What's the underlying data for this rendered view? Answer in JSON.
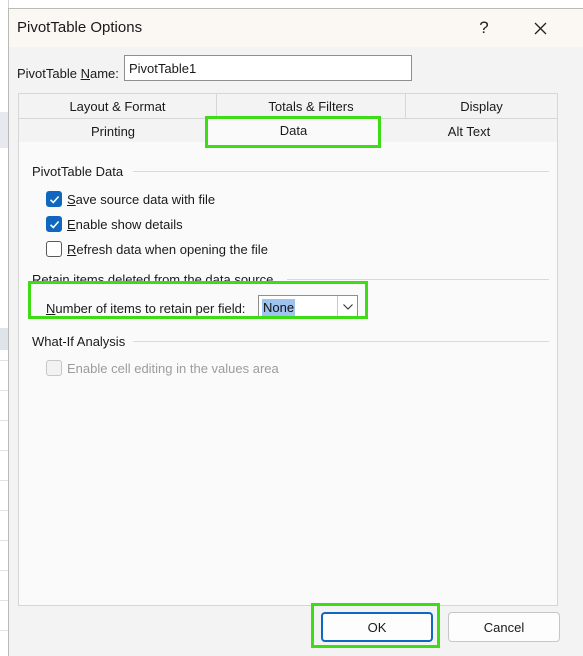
{
  "dialog": {
    "title": "PivotTable Options",
    "help_glyph": "?",
    "close_icon": "close-icon"
  },
  "name_field": {
    "label_prefix": "PivotTable ",
    "label_accel": "N",
    "label_suffix": "ame:",
    "value": "PivotTable1"
  },
  "tabs": {
    "row1": [
      {
        "label": "Layout & Format"
      },
      {
        "label": "Totals & Filters"
      },
      {
        "label": "Display"
      }
    ],
    "row2": [
      {
        "label": "Printing"
      },
      {
        "label": "Data",
        "active": true
      },
      {
        "label": "Alt Text"
      }
    ]
  },
  "pivot_data": {
    "heading": "PivotTable Data",
    "save": {
      "accel": "S",
      "rest": "ave source data with file",
      "checked": true
    },
    "enable": {
      "accel": "E",
      "rest": "nable show details",
      "checked": true
    },
    "refresh": {
      "accel": "R",
      "rest": "efresh data when opening the file",
      "checked": false
    }
  },
  "retain": {
    "heading": "Retain items deleted from the data source",
    "label_accel": "N",
    "label_rest": "umber of items to retain per field:",
    "value": "None"
  },
  "whatif": {
    "heading": "What-If Analysis",
    "option_label": "Enable cell editing in the values area",
    "checked": false,
    "disabled": true
  },
  "buttons": {
    "ok": "OK",
    "cancel": "Cancel"
  },
  "colors": {
    "highlight": "#3ddc14",
    "accent": "#0f67c0",
    "selection": "#9dc3ee"
  }
}
